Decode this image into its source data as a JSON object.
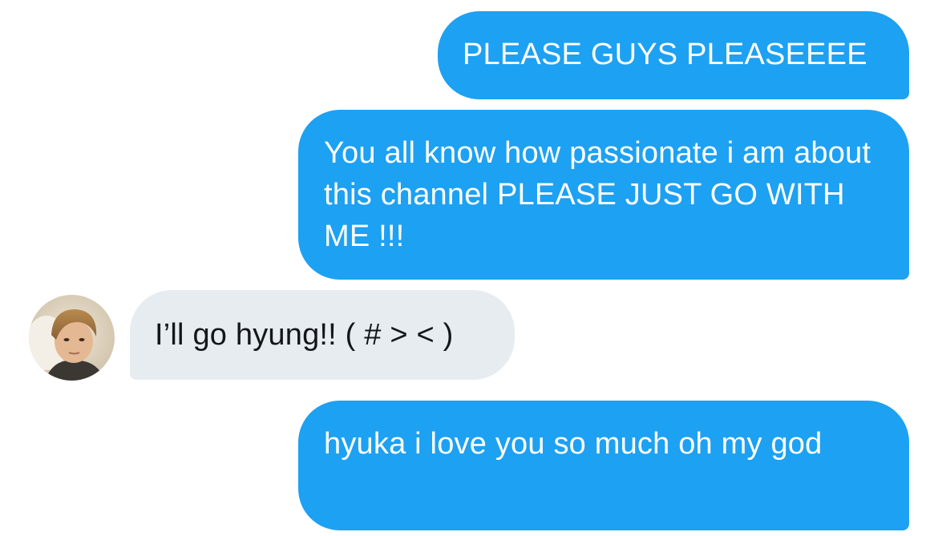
{
  "conversation": {
    "messages": [
      {
        "direction": "sent",
        "text": "PLEASE GUYS PLEASEEEE"
      },
      {
        "direction": "sent",
        "text": "You all know how passionate i am about this channel PLEASE JUST GO WITH ME !!!"
      },
      {
        "direction": "received",
        "text": "I’ll go hyung!! ( # > < )"
      },
      {
        "direction": "sent",
        "text": "hyuka i love you so much oh my god"
      }
    ]
  },
  "colors": {
    "sent_bubble": "#1da1f2",
    "received_bubble": "#e6ecf0",
    "sent_text": "#ffffff",
    "received_text": "#14171a"
  },
  "icons": {
    "avatar": "user-photo-avatar"
  }
}
